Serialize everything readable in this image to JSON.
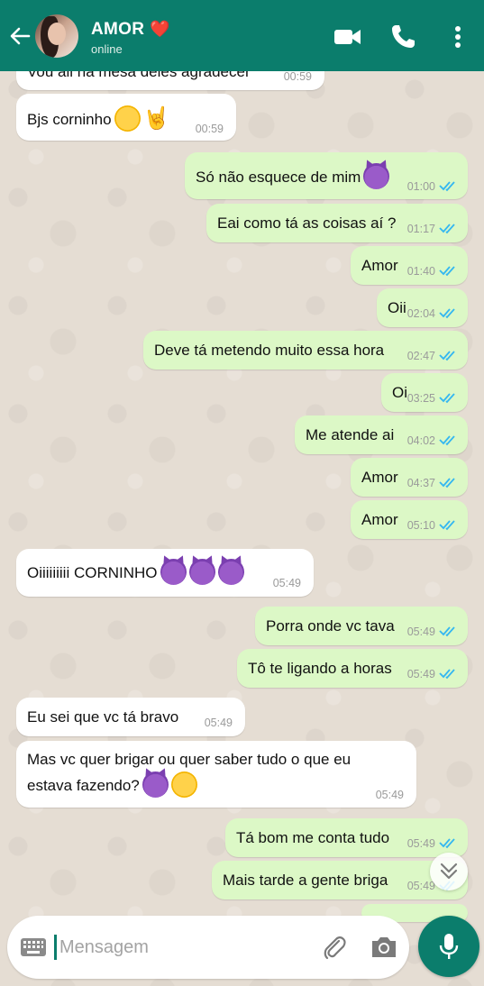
{
  "header": {
    "contact_name": "AMOR",
    "heart": "❤️",
    "status": "online"
  },
  "messages": [
    {
      "dir": "in",
      "text": "Vou ali na mesa deles agradecer",
      "time": "00:59"
    },
    {
      "dir": "in",
      "text": "Bjs corninho",
      "emojis": [
        "kiss",
        "horns"
      ],
      "time": "00:59"
    },
    {
      "dir": "out",
      "text": "Só não esquece de mim",
      "emojis": [
        "devil"
      ],
      "time": "01:00",
      "status": "read"
    },
    {
      "dir": "out",
      "text": "Eai como tá as coisas aí ?",
      "time": "01:17",
      "status": "read"
    },
    {
      "dir": "out",
      "text": "Amor",
      "time": "01:40",
      "status": "read"
    },
    {
      "dir": "out",
      "text": "Oii",
      "time": "02:04",
      "status": "read"
    },
    {
      "dir": "out",
      "text": "Deve tá metendo muito essa hora",
      "time": "02:47",
      "status": "read"
    },
    {
      "dir": "out",
      "text": "Oi",
      "time": "03:25",
      "status": "read"
    },
    {
      "dir": "out",
      "text": "Me atende ai",
      "time": "04:02",
      "status": "read"
    },
    {
      "dir": "out",
      "text": "Amor",
      "time": "04:37",
      "status": "read"
    },
    {
      "dir": "out",
      "text": "Amor",
      "time": "05:10",
      "status": "read"
    },
    {
      "dir": "in",
      "text": "Oiiiiiiiii CORNINHO",
      "emojis": [
        "devil",
        "devil",
        "devil"
      ],
      "time": "05:49"
    },
    {
      "dir": "out",
      "text": "Porra onde vc tava",
      "time": "05:49",
      "status": "read"
    },
    {
      "dir": "out",
      "text": "Tô te ligando a horas",
      "time": "05:49",
      "status": "read"
    },
    {
      "dir": "in",
      "text": "Eu sei que vc tá bravo",
      "time": "05:49"
    },
    {
      "dir": "in",
      "text_line1": "Mas vc quer brigar ou quer saber tudo o que eu",
      "text_line2": "estava fazendo?",
      "emojis": [
        "devil",
        "yum"
      ],
      "time": "05:49"
    },
    {
      "dir": "out",
      "text": "Tá bom me conta tudo",
      "time": "05:49",
      "status": "read"
    },
    {
      "dir": "out",
      "text": "Mais tarde a gente briga",
      "time": "05:49",
      "status": "read"
    }
  ],
  "input": {
    "placeholder": "Mensagem"
  },
  "colors": {
    "header": "#0b7d6c",
    "outgoing_bubble": "#dcf8c6",
    "incoming_bubble": "#ffffff",
    "read_ticks": "#34b7f1",
    "wallpaper": "#e5ddd3"
  },
  "icons": [
    "back-arrow-icon",
    "video-call-icon",
    "phone-icon",
    "more-vert-icon",
    "keyboard-icon",
    "attach-icon",
    "camera-icon",
    "mic-icon",
    "double-chevron-down-icon",
    "double-check-icon"
  ]
}
